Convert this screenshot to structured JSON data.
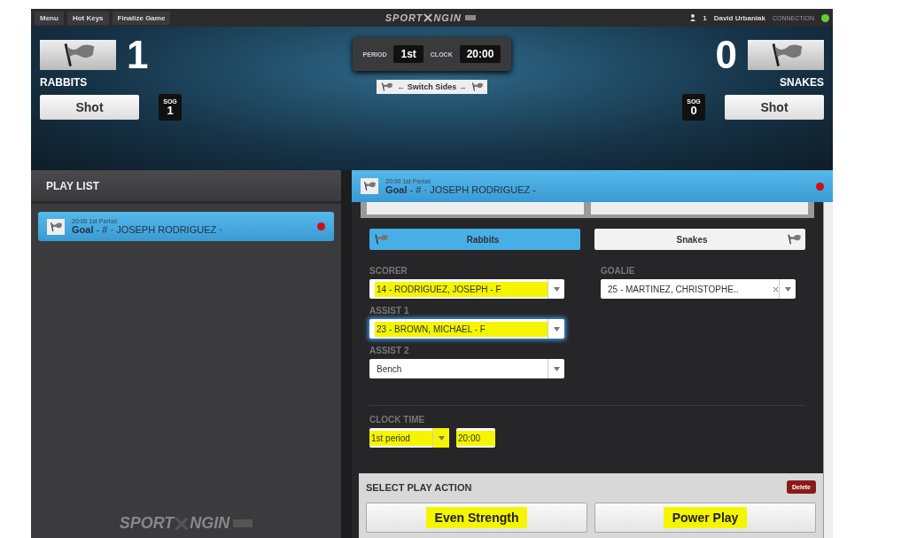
{
  "top_bar": {
    "menu": [
      "Menu",
      "Hot Keys",
      "Finalize Game"
    ],
    "logo": {
      "left": "SPORT",
      "right": "NGIN"
    },
    "user_count": "1",
    "user": "David Urbaniak",
    "connection": "CONNECTION"
  },
  "home": {
    "name": "RABBITS",
    "score": "1",
    "shot_button": "Shot",
    "sog_label": "SOG",
    "sog": "1"
  },
  "away": {
    "name": "SNAKES",
    "score": "0",
    "shot_button": "Shot",
    "sog_label": "SOG",
    "sog": "0"
  },
  "game": {
    "period_label": "PERIOD",
    "period": "1st",
    "clock_label": "CLOCK",
    "clock": "20:00",
    "switch_sides": "← Switch Sides →"
  },
  "play_list": {
    "title": "PLAY LIST",
    "items": [
      {
        "time": "20:00 1st Period",
        "type": "Goal",
        "detail": "- # · JOSEPH RODRIGUEZ ·",
        "selected": true
      }
    ],
    "footer_logo": {
      "left": "SPORT",
      "right": "NGIN"
    }
  },
  "play_detail": {
    "time": "20:00 1st Period",
    "type": "Goal",
    "detail": "- # · JOSEPH RODRIGUEZ -",
    "team_tabs": [
      {
        "label": "Rabbits",
        "selected": true
      },
      {
        "label": "Snakes",
        "selected": false
      }
    ],
    "left_fields": [
      {
        "label": "SCORER",
        "value": "14 - RODRIGUEZ, JOSEPH - F",
        "highlighted": true,
        "focused": false
      },
      {
        "label": "ASSIST 1",
        "value": "23 - BROWN, MICHAEL - F",
        "highlighted": true,
        "focused": true
      },
      {
        "label": "ASSIST 2",
        "value": "Bench",
        "highlighted": false,
        "focused": false
      }
    ],
    "right_fields": [
      {
        "label": "GOALIE",
        "value": "25 - MARTINEZ, CHRISTOPHE..",
        "highlighted": false,
        "focused": false
      }
    ],
    "clock_time": {
      "label": "CLOCK TIME",
      "period": "1st period",
      "time": "20:00",
      "highlighted": true
    },
    "action": {
      "title": "SELECT PLAY ACTION",
      "delete": "Delete",
      "buttons": [
        {
          "label": "Even Strength",
          "highlighted": true
        },
        {
          "label": "Power Play",
          "highlighted": true
        }
      ]
    }
  }
}
